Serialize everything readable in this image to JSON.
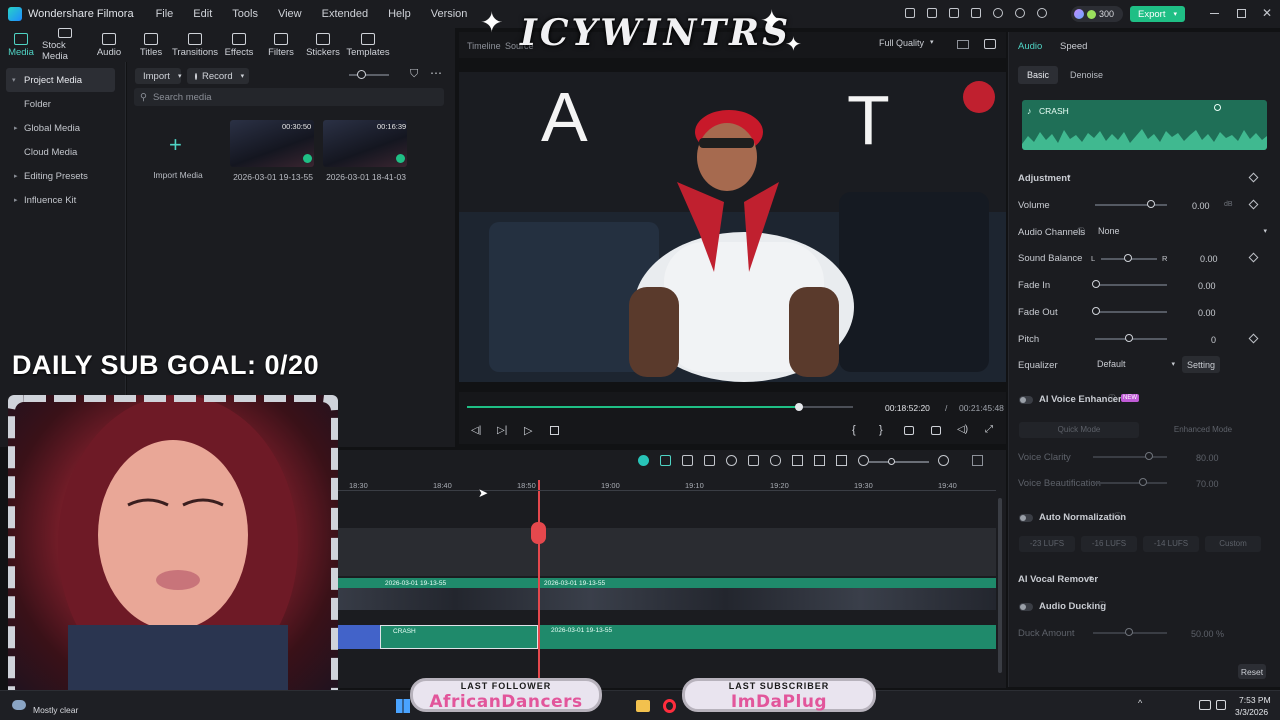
{
  "app": {
    "name": "Wondershare Filmora",
    "menu": [
      "File",
      "Edit",
      "Tools",
      "View",
      "Extended",
      "Help",
      "Version"
    ],
    "credits": "300",
    "export_label": "Export"
  },
  "toolbar": {
    "items": [
      "Media",
      "Stock Media",
      "Audio",
      "Titles",
      "Transitions",
      "Effects",
      "Filters",
      "Stickers",
      "Templates"
    ],
    "active": "Media"
  },
  "leftnav": {
    "items": [
      "Project Media",
      "Folder",
      "Global Media",
      "Cloud Media",
      "Editing Presets",
      "Influence Kit"
    ]
  },
  "media": {
    "import_label": "Import",
    "record_label": "Record",
    "search_placeholder": "Search media",
    "import_media_label": "Import Media",
    "clips": [
      {
        "name": "2026-03-01 19-13-55",
        "duration": "00:30:50"
      },
      {
        "name": "2026-03-01 18-41-03",
        "duration": "00:16:39"
      }
    ]
  },
  "preview": {
    "tabs": [
      "Timeline",
      "Source"
    ],
    "quality": "Full Quality",
    "current_time": "00:18:52:20",
    "separator": "/",
    "total_time": "00:21:45:48",
    "playhead_progress": 0.86
  },
  "rightpanel": {
    "tabs": [
      "Audio",
      "Speed"
    ],
    "subtabs": [
      "Basic",
      "Denoise"
    ],
    "clip_name": "CRASH",
    "adjustment_label": "Adjustment",
    "volume_label": "Volume",
    "volume_value": "0.00",
    "volume_unit": "dB",
    "channels_label": "Audio Channels",
    "channels_value": "None",
    "balance_label": "Sound Balance",
    "balance_left": "L",
    "balance_right": "R",
    "balance_value": "0.00",
    "fadein_label": "Fade In",
    "fadein_value": "0.00",
    "fadeout_label": "Fade Out",
    "fadeout_value": "0.00",
    "pitch_label": "Pitch",
    "pitch_value": "0",
    "equalizer_label": "Equalizer",
    "equalizer_value": "Default",
    "setting_label": "Setting",
    "voice_enhancer_label": "AI Voice Enhancer",
    "new_badge": "NEW",
    "quick_mode": "Quick Mode",
    "enhanced_mode": "Enhanced Mode",
    "voice_clarity_label": "Voice Clarity",
    "voice_clarity_value": "80.00",
    "voice_beautification_label": "Voice Beautification",
    "voice_beautification_value": "70.00",
    "auto_norm_label": "Auto Normalization",
    "norm_options": [
      "-23 LUFS",
      "-16 LUFS",
      "-14 LUFS",
      "Custom"
    ],
    "vocal_remover_label": "AI Vocal Remover",
    "ducking_label": "Audio Ducking",
    "duck_amount_label": "Duck Amount",
    "duck_amount_value": "50.00 %",
    "reset_label": "Reset"
  },
  "timeline": {
    "ticks": [
      "18:30",
      "18:40",
      "18:50",
      "19:00",
      "19:10",
      "19:20",
      "19:30",
      "19:40"
    ],
    "video_clips": [
      "2026-03-01 19-13-55",
      "2026-03-01 19-13-55"
    ],
    "audio_clips": [
      "CRASH",
      "2026-03-01 19-13-55"
    ]
  },
  "overlay": {
    "banner": "ICYWINTRS",
    "goal": "DAILY SUB GOAL: 0/20",
    "preview_letters": [
      "A",
      "T"
    ],
    "last_follower_title": "LAST FOLLOWER",
    "last_follower_name": "AfricanDancers",
    "last_sub_title": "LAST SUBSCRIBER",
    "last_sub_name": "ImDaPlug"
  },
  "taskbar": {
    "weather": "Mostly clear",
    "time": "7:53 PM",
    "date": "3/3/2026"
  },
  "colors": {
    "accent": "#4fd3c4",
    "export": "#1fbf85",
    "track_green": "#1f8a6b",
    "playhead": "#e5484d"
  }
}
